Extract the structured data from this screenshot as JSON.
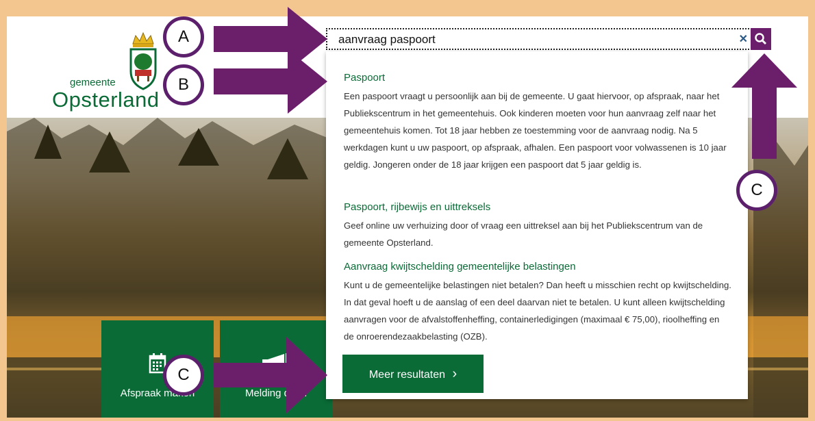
{
  "logo": {
    "line1": "gemeente",
    "line2": "Opsterland"
  },
  "search": {
    "value": "aanvraag paspoort",
    "clear_symbol": "✕"
  },
  "results": [
    {
      "title": "Paspoort",
      "description": "Een paspoort vraagt u persoonlijk aan bij de gemeente. U gaat hiervoor, op afspraak, naar het Publiekscentrum in het gemeentehuis. Ook kinderen moeten voor hun aanvraag zelf naar het gemeentehuis komen. Tot 18 jaar hebben ze toestemming voor de aanvraag nodig. Na 5 werkdagen kunt u uw paspoort, op afspraak, afhalen. Een paspoort voor volwassenen is 10 jaar geldig. Jongeren onder de 18 jaar krijgen een paspoort dat 5 jaar geldig is."
    },
    {
      "title": "Paspoort, rijbewijs en uittreksels",
      "description": "Geef online uw verhuizing door of vraag een uittreksel aan bij het Publiekscentrum van de gemeente Opsterland."
    },
    {
      "title": "Aanvraag kwijtschelding gemeentelijke belastingen",
      "description": "Kunt u de gemeentelijke belastingen niet betalen? Dan heeft u misschien recht op kwijtschelding. In dat geval hoeft u de aanslag of een deel daarvan niet te betalen. U kunt alleen kwijtschelding aanvragen voor de afvalstoffenheffing, containerledigingen (maximaal € 75,00), rioolheffing en de onroerendezaakbelasting (OZB)."
    }
  ],
  "more_button": {
    "label": "Meer resultaten",
    "chevron": "›"
  },
  "tiles": [
    {
      "label": "Afspraak maken",
      "icon": "calendar-icon"
    },
    {
      "label": "Melding doen",
      "icon": "megaphone-icon"
    }
  ],
  "annotations": {
    "a": "A",
    "b": "B",
    "c1": "C",
    "c2": "C"
  },
  "colors": {
    "border": "#f2c68e",
    "green": "#0a6b36",
    "purple": "#5b1f6b",
    "search_button": "#6b1e6b"
  }
}
